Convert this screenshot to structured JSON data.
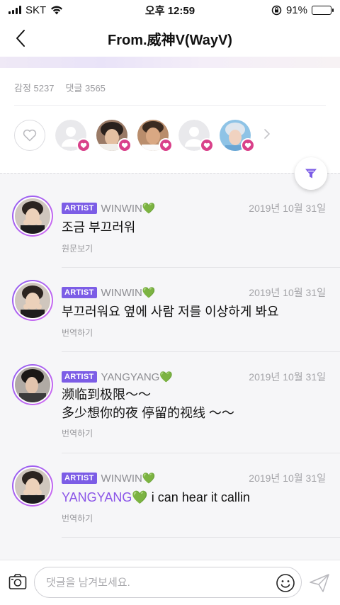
{
  "status_bar": {
    "carrier": "SKT",
    "time": "오후 12:59",
    "battery": "91%",
    "battery_level": 0.91
  },
  "header": {
    "title": "From.威神V(WayV)"
  },
  "stats": {
    "emotions": "감정 5237",
    "comments": "댓글 3565"
  },
  "reactors": [
    "user",
    "photo",
    "photo",
    "user",
    "photo"
  ],
  "comments": [
    {
      "badge": "ARTIST",
      "name": "WINWIN💚",
      "date": "2019년 10월 31일",
      "text": "조금 부끄러워",
      "action": "원문보기"
    },
    {
      "badge": "ARTIST",
      "name": "WINWIN💚",
      "date": "2019년 10월 31일",
      "text": "부끄러워요 옆에 사람 저를 이상하게 봐요",
      "action": "번역하기"
    },
    {
      "badge": "ARTIST",
      "name": "YANGYANG💚",
      "date": "2019년 10월 31일",
      "line1": "濒临到极限～～",
      "line2": "多少想你的夜 停留的视线 ～～",
      "action": "번역하기"
    },
    {
      "badge": "ARTIST",
      "name": "WINWIN💚",
      "date": "2019년 10월 31일",
      "mention": "YANGYANG",
      "rest": "💚 i can hear it callin",
      "action": "번역하기"
    }
  ],
  "input": {
    "placeholder": "댓글을 남겨보세요."
  },
  "colors": {
    "accent": "#7c5de6",
    "heart_badge": "#d9418a",
    "mention": "#8b55e8"
  }
}
